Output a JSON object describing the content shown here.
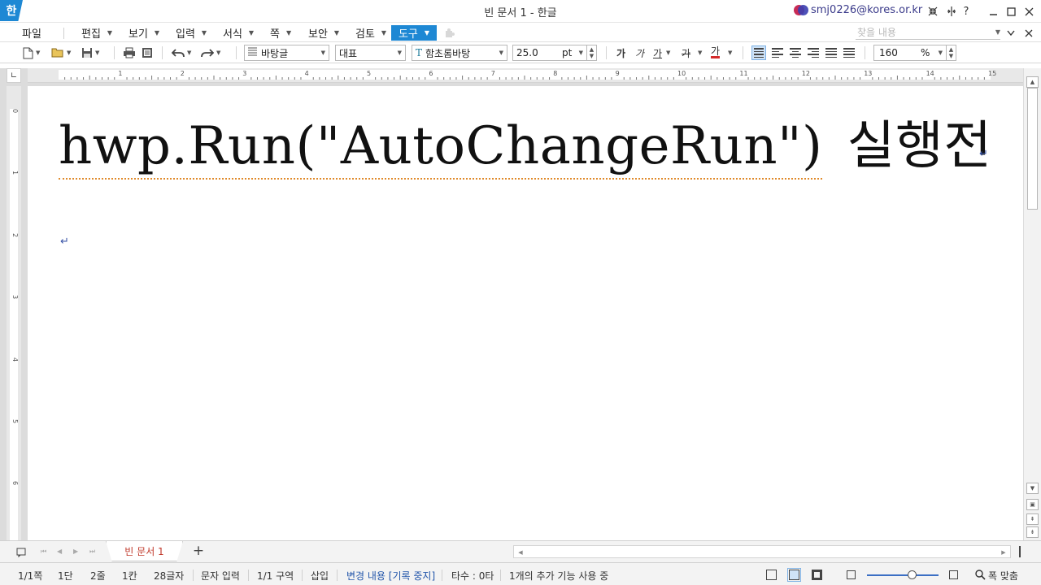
{
  "titlebar": {
    "app_logo": "한",
    "title": "빈 문서 1 - 한글",
    "account": "smj0226@kores.or.kr",
    "icons": [
      "shrink-icon",
      "ribbon-toggle-icon",
      "help-icon",
      "minimize-icon",
      "maximize-icon",
      "close-icon"
    ],
    "help": "?"
  },
  "menu": {
    "items": [
      "파일",
      "편집",
      "보기",
      "입력",
      "서식",
      "쪽",
      "보안",
      "검토",
      "도구"
    ],
    "active": "도구",
    "search_placeholder": "찾을 내용"
  },
  "toolbar": {
    "style": "바탕글",
    "language": "대표",
    "font": "함초롬바탕",
    "font_icon": "T",
    "size": "25.0",
    "size_unit": "pt",
    "bold": "가",
    "italic": "가",
    "underline": "가",
    "strike": "가",
    "color": "가",
    "text_color": "#d42b2b",
    "zoom": "160",
    "zoom_unit": "%"
  },
  "ruler": {
    "h_numbers": [
      "1",
      "2",
      "3",
      "4",
      "5",
      "6",
      "7",
      "8",
      "9",
      "10",
      "11",
      "12",
      "13",
      "14",
      "15"
    ],
    "v_numbers": [
      "0",
      "1",
      "2",
      "3",
      "4",
      "5",
      "6"
    ]
  },
  "document": {
    "code_text": "hwp.Run(\"AutoChangeRun\")",
    "korean_text": "실행전",
    "para_mark": "↵"
  },
  "tabs": {
    "doc_tab": "빈 문서 1",
    "add": "+"
  },
  "status": {
    "page": "1/1쪽",
    "column": "1단",
    "line": "2줄",
    "cell": "1칸",
    "chars": "28글자",
    "input_mode": "문자 입력",
    "section": "1/1 구역",
    "insert": "삽입",
    "track_changes": "변경 내용 [기록 중지]",
    "typing": "타수 : 0타",
    "addon": "1개의 추가 기능 사용 중",
    "zoom_label": "폭 맞춤"
  },
  "colors": {
    "accent": "#1e88d4",
    "link": "#2255aa",
    "spell_underline": "#e08a2a"
  }
}
